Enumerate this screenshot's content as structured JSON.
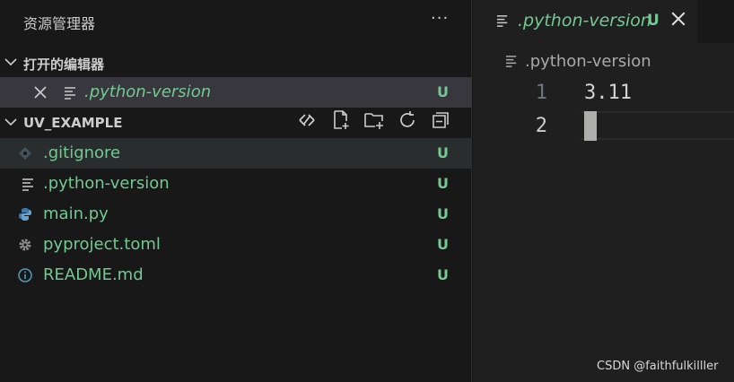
{
  "explorer": {
    "title": "资源管理器",
    "more": "···",
    "open_editors": {
      "label": "打开的编辑器",
      "items": [
        {
          "name": ".python-version",
          "status": "U"
        }
      ]
    },
    "project": {
      "label": "UV_EXAMPLE",
      "files": [
        {
          "name": ".gitignore",
          "status": "U",
          "icon": "git-icon"
        },
        {
          "name": ".python-version",
          "status": "U",
          "icon": "lines-icon"
        },
        {
          "name": "main.py",
          "status": "U",
          "icon": "python-icon"
        },
        {
          "name": "pyproject.toml",
          "status": "U",
          "icon": "gear-icon"
        },
        {
          "name": "README.md",
          "status": "U",
          "icon": "info-icon"
        }
      ]
    }
  },
  "editor": {
    "tab": {
      "name": ".python-version",
      "status": "U"
    },
    "breadcrumb": ".python-version",
    "lines": [
      {
        "num": "1",
        "text": "3.11"
      },
      {
        "num": "2",
        "text": ""
      }
    ]
  },
  "watermark": "CSDN @faithfulkilller",
  "colors": {
    "untracked": "#73c991",
    "selection": "#37373d",
    "background": "#181818"
  }
}
